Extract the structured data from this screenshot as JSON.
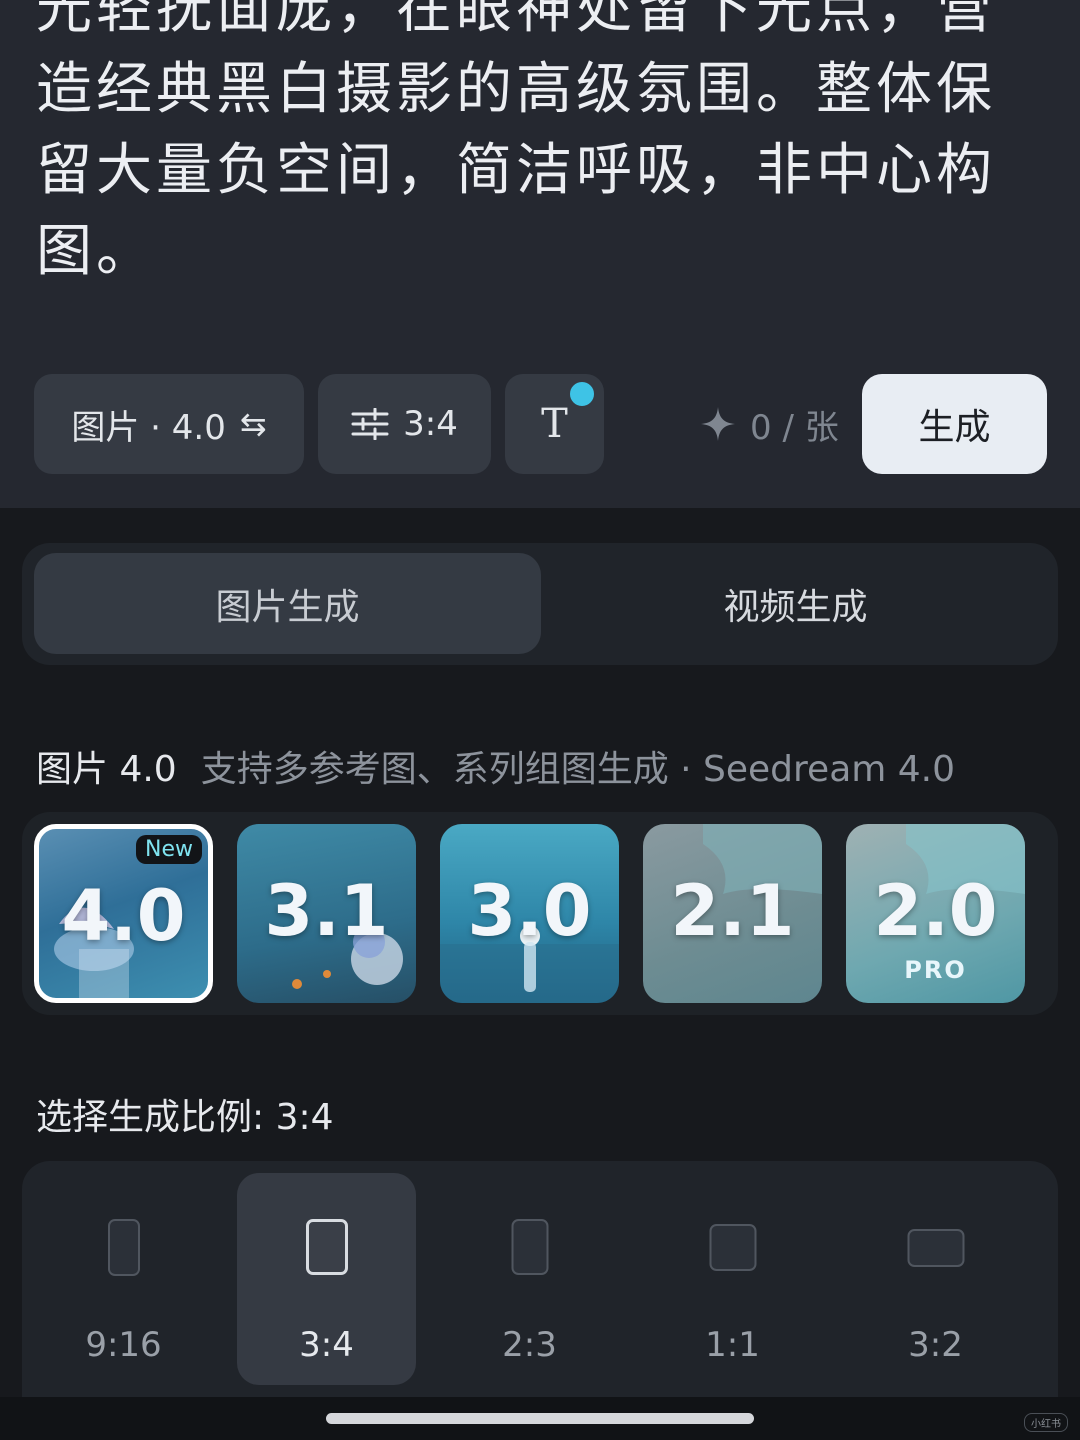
{
  "prompt": {
    "text": "光轻抚面庞，在眼神处留下光点，营\n造经典黑白摄影的高级氛围。整体保\n留大量负空间，简洁呼吸，非中心构\n图。"
  },
  "toolbar": {
    "model_label": "图片 · 4.0",
    "ratio_label": "3:4",
    "text_icon_label": "T",
    "credits": "0 / 张",
    "generate_label": "生成"
  },
  "segment": {
    "image_tab": "图片生成",
    "video_tab": "视频生成"
  },
  "model_section": {
    "name": "图片 4.0",
    "description": "支持多参考图、系列组图生成 · Seedream 4.0",
    "models": [
      {
        "version": "4.0",
        "badge": "New",
        "sub": "",
        "selected": true
      },
      {
        "version": "3.1",
        "badge": "",
        "sub": "",
        "selected": false
      },
      {
        "version": "3.0",
        "badge": "",
        "sub": "",
        "selected": false
      },
      {
        "version": "2.1",
        "badge": "",
        "sub": "",
        "selected": false
      },
      {
        "version": "2.0",
        "badge": "",
        "sub": "PRO",
        "selected": false
      }
    ]
  },
  "ratio_section": {
    "title": "选择生成比例: 3:4",
    "ratios": [
      {
        "label": "9:16",
        "selected": false
      },
      {
        "label": "3:4",
        "selected": true
      },
      {
        "label": "2:3",
        "selected": false
      },
      {
        "label": "1:1",
        "selected": false
      },
      {
        "label": "3:2",
        "selected": false
      }
    ]
  },
  "colors": {
    "accent_dot": "#3ec3e6",
    "new_badge_text": "#7fe3ef"
  },
  "watermark": "小红书"
}
